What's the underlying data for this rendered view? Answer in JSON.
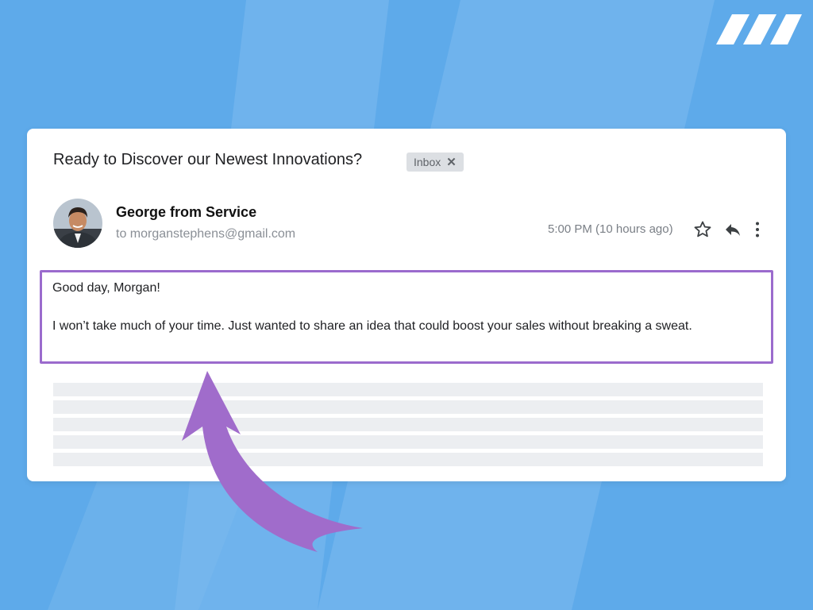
{
  "email": {
    "subject": "Ready to Discover our Newest Innovations?",
    "label": "Inbox",
    "label_remove": "✕",
    "sender": "George from Service",
    "recipient": "to morganstephens@gmail.com",
    "time": "5:00 PM (10 hours ago)",
    "greeting": "Good day, Morgan!",
    "body": "I won’t take much of your time. Just wanted to share an idea that could boost your sales without breaking a sweat."
  },
  "icons": {
    "star": "star-icon",
    "reply": "reply-icon",
    "more": "more-vertical-icon",
    "logo": "brand-logo-stripes",
    "arrow": "curved-arrow"
  },
  "colors": {
    "background": "#5eaaea",
    "card": "#ffffff",
    "highlight": "#9b6bcd",
    "arrow": "#a06ccb",
    "placeholder": "#eceef1"
  }
}
